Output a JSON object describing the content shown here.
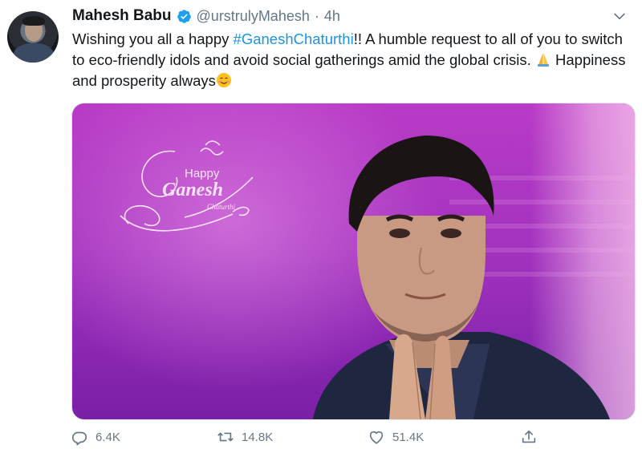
{
  "tweet": {
    "author_name": "Mahesh Babu",
    "handle": "@urstrulyMahesh",
    "separator": "·",
    "time": "4h",
    "text_part1": "Wishing you all a happy ",
    "hashtag": "#GaneshChaturthi",
    "text_part2": "!! A humble request to all of you to switch to eco-friendly idols and avoid social gatherings amid the global crisis. ",
    "text_part3": " Happiness and prosperity always",
    "emoji_1": "folded-hands-emoji",
    "emoji_2": "smiling-face-emoji"
  },
  "media": {
    "happy": "Happy",
    "ganesh": "Ganesh",
    "chaturthi": "Chaturthi"
  },
  "actions": {
    "reply_count": "6.4K",
    "retweet_count": "14.8K",
    "like_count": "51.4K",
    "share_icon": "share-icon"
  },
  "colors": {
    "hashtag": "#1b95e0",
    "verified": "#1da1f2",
    "muted": "#657786",
    "media_purple": "#a433bf"
  }
}
